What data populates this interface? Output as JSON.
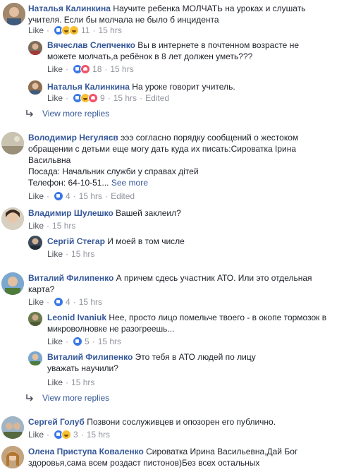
{
  "labels": {
    "like": "Like",
    "sep": "·",
    "edited": "Edited",
    "view_more": "View more replies",
    "see_more": "See more"
  },
  "c1": {
    "author": "Наталья Калинкина",
    "text": "Научите ребенка МОЛЧАТЬ на уроках и слушать учителя. Если бы молчала не было б инцидента",
    "count": "11",
    "time": "15 hrs",
    "reactions": [
      "like",
      "wow",
      "haha"
    ]
  },
  "c1r1": {
    "author": "Вячеслав Слепченко",
    "text": "Вы в интернете в почтенном возрасте не можете молчать,а ребёнок в 8 лет должен уметь???",
    "count": "18",
    "time": "15 hrs",
    "reactions": [
      "like",
      "love"
    ]
  },
  "c1r2": {
    "author": "Наталья Калинкина",
    "text": "На уроке говорит учитель.",
    "count": "9",
    "time": "15 hrs",
    "reactions": [
      "like",
      "haha",
      "love"
    ]
  },
  "c2": {
    "author": "Володимир Негуляєв",
    "text": "эээ согласно порядку сообщений о жестоком обращении с детьми еще могу дать куда их писать:Сироватка Ірина Васильвна",
    "line2": "Посада: Начальник служби у справах дітей",
    "line3": "Телефон: 64-10-51...",
    "count": "4",
    "time": "15 hrs",
    "reactions": [
      "like"
    ]
  },
  "c3": {
    "author": "Владимир Шулешко",
    "text": "Вашей заклеил?",
    "time": "15 hrs"
  },
  "c3r1": {
    "author": "Сергій Стегар",
    "text": "И моей в том числе",
    "time": "15 hrs"
  },
  "c4": {
    "author": "Виталий Филипенко",
    "text": "А причем сдесь участник АТО. Или это отдельная карта?",
    "count": "4",
    "time": "15 hrs",
    "reactions": [
      "like"
    ]
  },
  "c4r1": {
    "author": "Leonid Ivaniuk",
    "text": "Нее, просто лицо помельче твоего - в окопе тормозок в микроволновке не разогреешь...",
    "count": "5",
    "time": "15 hrs",
    "reactions": [
      "like"
    ]
  },
  "c4r2": {
    "author": "Виталий Филипенко",
    "text": "Это тебя в АТО людей по лицу уважать научили?",
    "time": "15 hrs"
  },
  "c5": {
    "author": "Сергей Голуб",
    "text": "Позвони сослуживцев и опозорен его публично.",
    "count": "3",
    "time": "15 hrs",
    "reactions": [
      "like",
      "haha"
    ]
  },
  "c6": {
    "author": "Олена Приступа Коваленко",
    "text": "Сироватка Ирина Васильевна,Дай Бог здоровья,сама всем роздаст пистонов)Без всех остальных"
  }
}
